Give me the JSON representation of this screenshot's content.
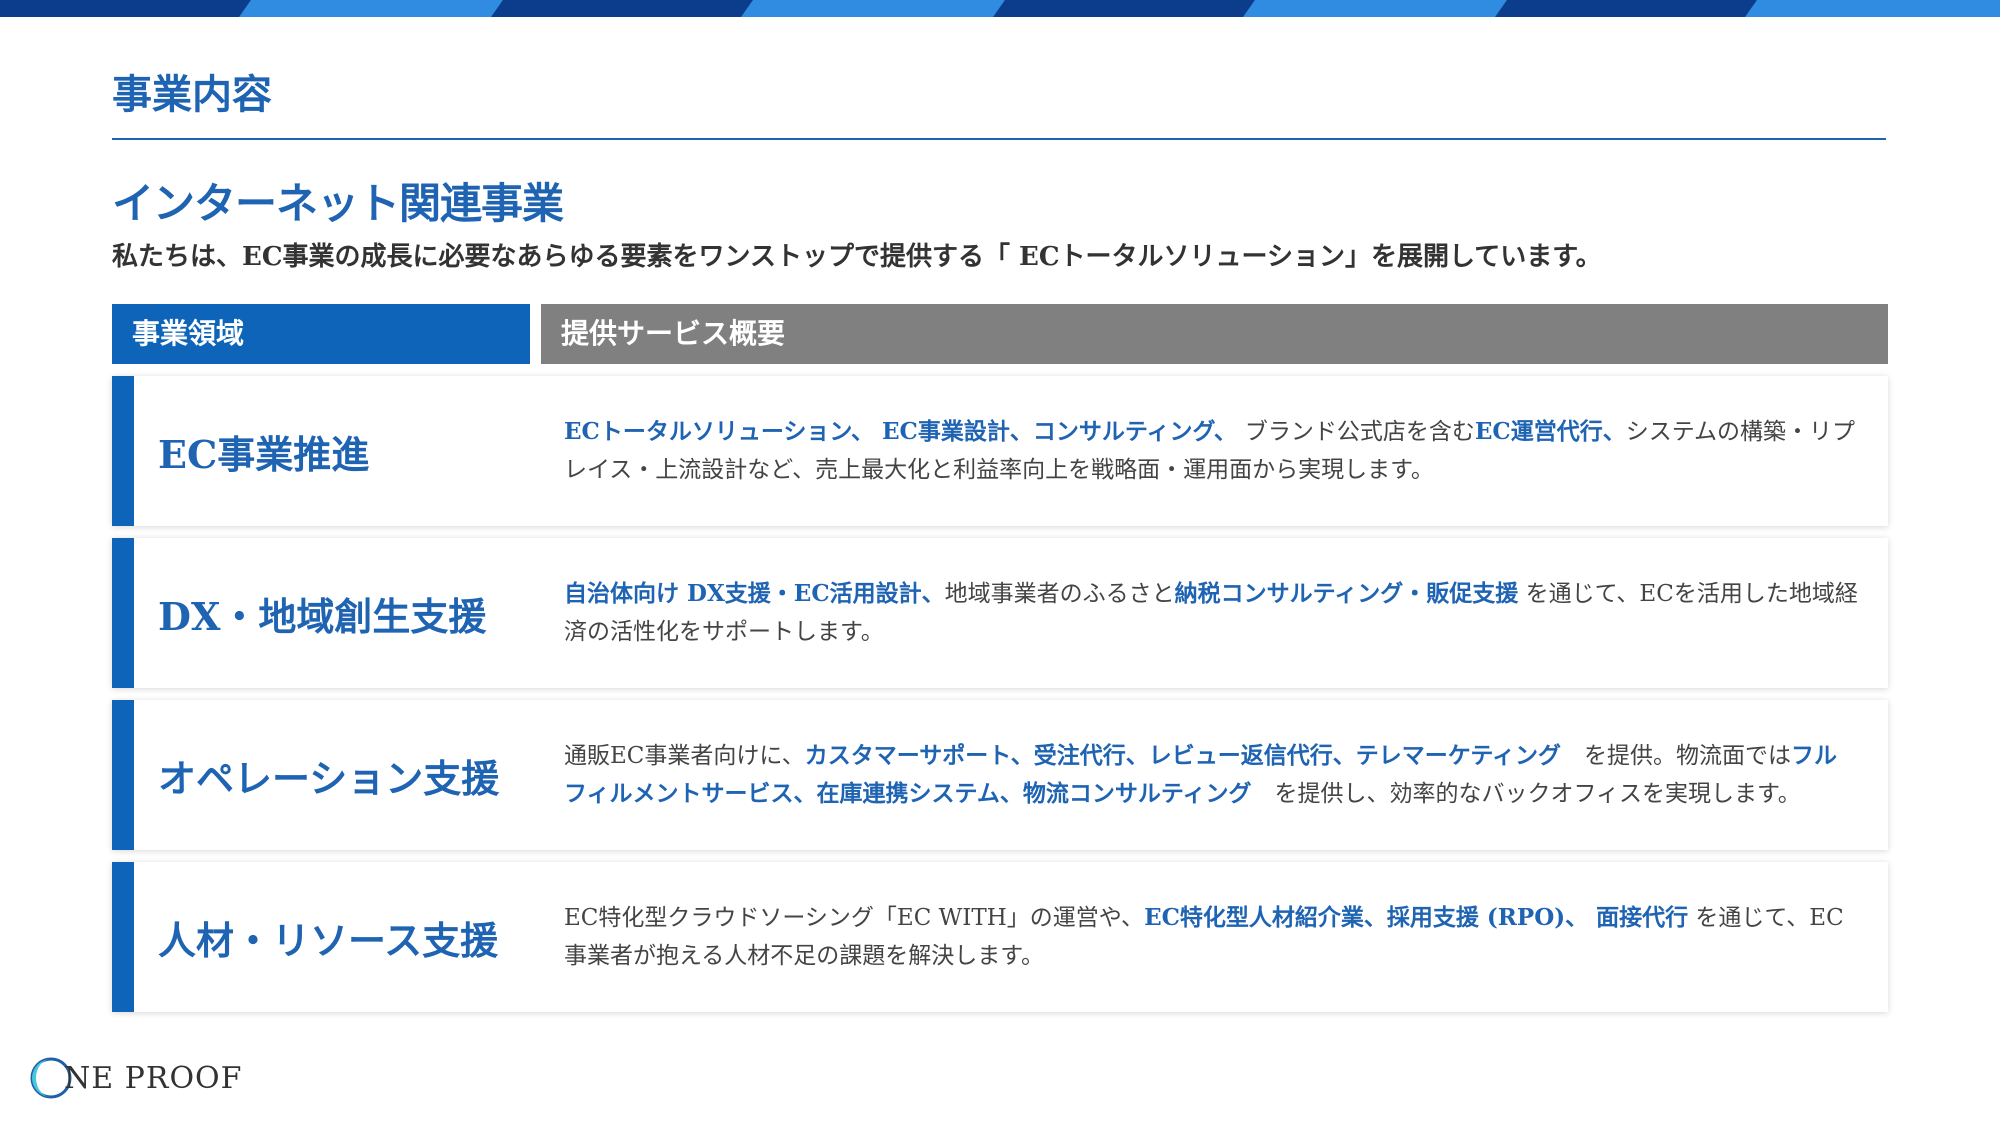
{
  "page": {
    "title": "事業内容",
    "section_title": "インターネット関連事業",
    "lead": "私たちは、EC事業の成長に必要なあらゆる要素をワンストップで提供する「 ECトータルソリューション」を展開しています。"
  },
  "table": {
    "headers": [
      "事業領域",
      "提供サービス概要"
    ],
    "rows": [
      {
        "name": "EC事業推進",
        "desc": [
          {
            "t": "ECトータルソリューション、 EC事業設計、コンサルティング、 ",
            "hl": true
          },
          {
            "t": "ブランド公式店を含む",
            "hl": false
          },
          {
            "t": "EC運営代行、",
            "hl": true
          },
          {
            "t": "システムの構築・リプレイス・上流設計など、売上最大化と利益率向上を戦略面・運用面から実現します。",
            "hl": false
          }
        ]
      },
      {
        "name": "DX・地域創生支援",
        "desc": [
          {
            "t": "自治体向け DX支援・EC活用設計、",
            "hl": true
          },
          {
            "t": "地域事業者のふるさと",
            "hl": false
          },
          {
            "t": "納税コンサルティング・販促支援",
            "hl": true
          },
          {
            "t": " を通じて、ECを活用した地域経済の活性化をサポートします。",
            "hl": false
          }
        ]
      },
      {
        "name": "オペレーション支援",
        "desc": [
          {
            "t": "通販EC事業者向けに、",
            "hl": false
          },
          {
            "t": "カスタマーサポート、受注代行、レビュー返信代行、テレマーケティング",
            "hl": true
          },
          {
            "t": "　を提供。物流面では",
            "hl": false
          },
          {
            "t": "フルフィルメントサービス、在庫連携システム、物流コンサルティング",
            "hl": true
          },
          {
            "t": "　を提供し、効率的なバックオフィスを実現します。",
            "hl": false
          }
        ]
      },
      {
        "name": "人材・リソース支援",
        "desc": [
          {
            "t": "EC特化型クラウドソーシング「EC WITH」の運営や、",
            "hl": false
          },
          {
            "t": "EC特化型人材紹介業、採用支援 (RPO)、 面接代行",
            "hl": true
          },
          {
            "t": " を通じて、EC事業者が抱える人材不足の課題を解決します。",
            "hl": false
          }
        ]
      }
    ]
  },
  "logo": {
    "text": "NE PROOF",
    "icon": "crescent-o-icon",
    "colors": [
      "#1f5fa8",
      "#47c6e0"
    ]
  },
  "colors": {
    "accent": "#1f63b3",
    "header_blue": "#0d64b8",
    "header_gray": "#808080",
    "topbar_dark": "#0b3d8c",
    "topbar_light": "#2f8ce0"
  }
}
